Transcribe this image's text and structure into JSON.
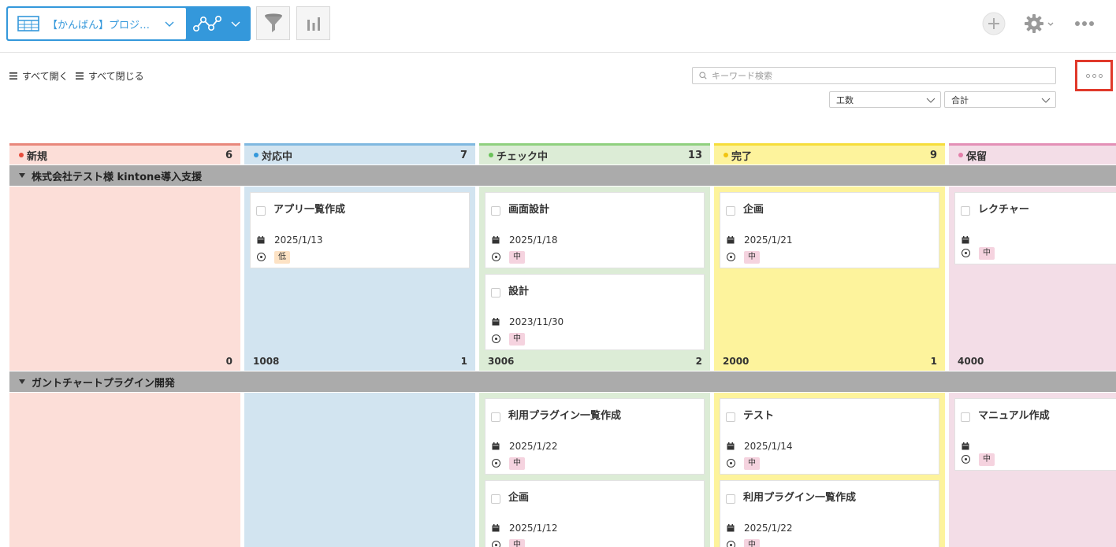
{
  "toolbar": {
    "view_name": "【かんばん】プロジェ…",
    "filter_icon": "filter-icon",
    "graph_icon": "bar-chart-icon"
  },
  "subheader": {
    "expand_all": "すべて開く",
    "collapse_all": "すべて閉じる",
    "search_placeholder": "キーワード検索",
    "field_select": "工数",
    "agg_select": "合計"
  },
  "colors": {
    "accent": "#3498db",
    "highlight": "#e0392b",
    "prio_low": "#fde2c4",
    "prio_mid": "#f5d3df"
  },
  "columns": [
    {
      "label": "新規",
      "count": "6"
    },
    {
      "label": "対応中",
      "count": "7"
    },
    {
      "label": "チェック中",
      "count": "13"
    },
    {
      "label": "完了",
      "count": "9"
    },
    {
      "label": "保留",
      "count": ""
    }
  ],
  "groups": [
    {
      "label": "株式会社テスト様 kintone導入支援",
      "cells": [
        {
          "sum": "",
          "count": "0",
          "cards": []
        },
        {
          "sum": "1008",
          "count": "1",
          "cards": [
            {
              "title": "アプリ一覧作成",
              "date": "2025/1/13",
              "priority": "低"
            }
          ]
        },
        {
          "sum": "3006",
          "count": "2",
          "cards": [
            {
              "title": "画面設計",
              "date": "2025/1/18",
              "priority": "中"
            },
            {
              "title": "設計",
              "date": "2023/11/30",
              "priority": "中"
            }
          ]
        },
        {
          "sum": "2000",
          "count": "1",
          "cards": [
            {
              "title": "企画",
              "date": "2025/1/21",
              "priority": "中"
            }
          ]
        },
        {
          "sum": "4000",
          "count": "",
          "cards": [
            {
              "title": "レクチャー",
              "date": "",
              "priority": "中"
            }
          ]
        }
      ]
    },
    {
      "label": "ガントチャートプラグイン開発",
      "cells": [
        {
          "cards": []
        },
        {
          "cards": []
        },
        {
          "cards": [
            {
              "title": "利用プラグイン一覧作成",
              "date": "2025/1/22",
              "priority": "中"
            },
            {
              "title": "企画",
              "date": "2025/1/12",
              "priority": "中"
            }
          ]
        },
        {
          "cards": [
            {
              "title": "テスト",
              "date": "2025/1/14",
              "priority": "中"
            },
            {
              "title": "利用プラグイン一覧作成",
              "date": "2025/1/22",
              "priority": "中"
            }
          ]
        },
        {
          "cards": [
            {
              "title": "マニュアル作成",
              "date": "",
              "priority": "中"
            }
          ]
        }
      ]
    }
  ]
}
